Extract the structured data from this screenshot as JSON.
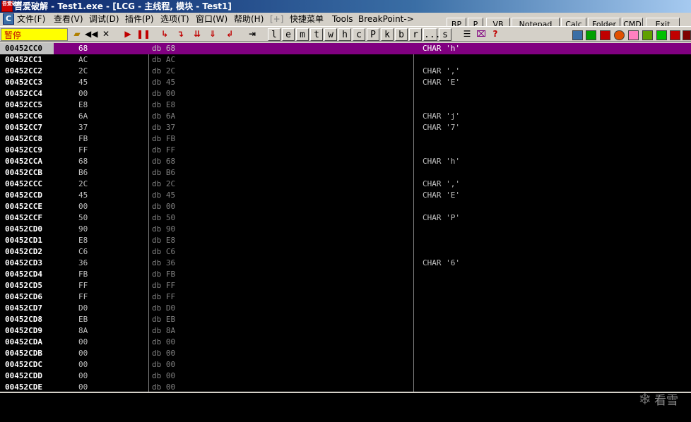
{
  "window": {
    "title": "吾爱破解 - Test1.exe - [LCG - 主线程, 模块 - Test1]",
    "icon_text": "吾爱破解"
  },
  "menu": {
    "mdi_icon": "C",
    "items": [
      "文件(F)",
      "查看(V)",
      "调试(D)",
      "插件(P)",
      "选项(T)",
      "窗口(W)",
      "帮助(H)",
      "[+]",
      "快捷菜单",
      "Tools",
      "BreakPoint->"
    ]
  },
  "plugins": [
    "BP",
    "P",
    "VB",
    "Notepad",
    "Calc",
    "Folder",
    "CMD",
    "Exit"
  ],
  "toolbar": {
    "status": "暂停",
    "letters": [
      "l",
      "e",
      "m",
      "t",
      "w",
      "h",
      "c",
      "P",
      "k",
      "b",
      "r",
      "...",
      "s"
    ]
  },
  "dump": {
    "rows": [
      {
        "addr": "00452CC0",
        "hex": "68",
        "dis": "db 68",
        "cmt": "CHAR 'h'",
        "selected": true
      },
      {
        "addr": "00452CC1",
        "hex": "AC",
        "dis": "db AC",
        "cmt": ""
      },
      {
        "addr": "00452CC2",
        "hex": "2C",
        "dis": "db 2C",
        "cmt": "CHAR ','"
      },
      {
        "addr": "00452CC3",
        "hex": "45",
        "dis": "db 45",
        "cmt": "CHAR 'E'"
      },
      {
        "addr": "00452CC4",
        "hex": "00",
        "dis": "db 00",
        "cmt": ""
      },
      {
        "addr": "00452CC5",
        "hex": "E8",
        "dis": "db E8",
        "cmt": ""
      },
      {
        "addr": "00452CC6",
        "hex": "6A",
        "dis": "db 6A",
        "cmt": "CHAR 'j'"
      },
      {
        "addr": "00452CC7",
        "hex": "37",
        "dis": "db 37",
        "cmt": "CHAR '7'"
      },
      {
        "addr": "00452CC8",
        "hex": "FB",
        "dis": "db FB",
        "cmt": ""
      },
      {
        "addr": "00452CC9",
        "hex": "FF",
        "dis": "db FF",
        "cmt": ""
      },
      {
        "addr": "00452CCA",
        "hex": "68",
        "dis": "db 68",
        "cmt": "CHAR 'h'"
      },
      {
        "addr": "00452CCB",
        "hex": "B6",
        "dis": "db B6",
        "cmt": ""
      },
      {
        "addr": "00452CCC",
        "hex": "2C",
        "dis": "db 2C",
        "cmt": "CHAR ','"
      },
      {
        "addr": "00452CCD",
        "hex": "45",
        "dis": "db 45",
        "cmt": "CHAR 'E'"
      },
      {
        "addr": "00452CCE",
        "hex": "00",
        "dis": "db 00",
        "cmt": ""
      },
      {
        "addr": "00452CCF",
        "hex": "50",
        "dis": "db 50",
        "cmt": "CHAR 'P'"
      },
      {
        "addr": "00452CD0",
        "hex": "90",
        "dis": "db 90",
        "cmt": ""
      },
      {
        "addr": "00452CD1",
        "hex": "E8",
        "dis": "db E8",
        "cmt": ""
      },
      {
        "addr": "00452CD2",
        "hex": "C6",
        "dis": "db C6",
        "cmt": ""
      },
      {
        "addr": "00452CD3",
        "hex": "36",
        "dis": "db 36",
        "cmt": "CHAR '6'"
      },
      {
        "addr": "00452CD4",
        "hex": "FB",
        "dis": "db FB",
        "cmt": ""
      },
      {
        "addr": "00452CD5",
        "hex": "FF",
        "dis": "db FF",
        "cmt": ""
      },
      {
        "addr": "00452CD6",
        "hex": "FF",
        "dis": "db FF",
        "cmt": ""
      },
      {
        "addr": "00452CD7",
        "hex": "D0",
        "dis": "db D0",
        "cmt": ""
      },
      {
        "addr": "00452CD8",
        "hex": "EB",
        "dis": "db EB",
        "cmt": ""
      },
      {
        "addr": "00452CD9",
        "hex": "8A",
        "dis": "db 8A",
        "cmt": ""
      },
      {
        "addr": "00452CDA",
        "hex": "00",
        "dis": "db 00",
        "cmt": ""
      },
      {
        "addr": "00452CDB",
        "hex": "00",
        "dis": "db 00",
        "cmt": ""
      },
      {
        "addr": "00452CDC",
        "hex": "00",
        "dis": "db 00",
        "cmt": ""
      },
      {
        "addr": "00452CDD",
        "hex": "00",
        "dis": "db 00",
        "cmt": ""
      },
      {
        "addr": "00452CDE",
        "hex": "00",
        "dis": "db 00",
        "cmt": ""
      }
    ]
  },
  "watermark": {
    "icon": "snowflake-icon",
    "text": "看雪"
  },
  "colors": {
    "selection": "#800080",
    "status_bg": "#ffff00",
    "status_fg": "#c00000"
  }
}
